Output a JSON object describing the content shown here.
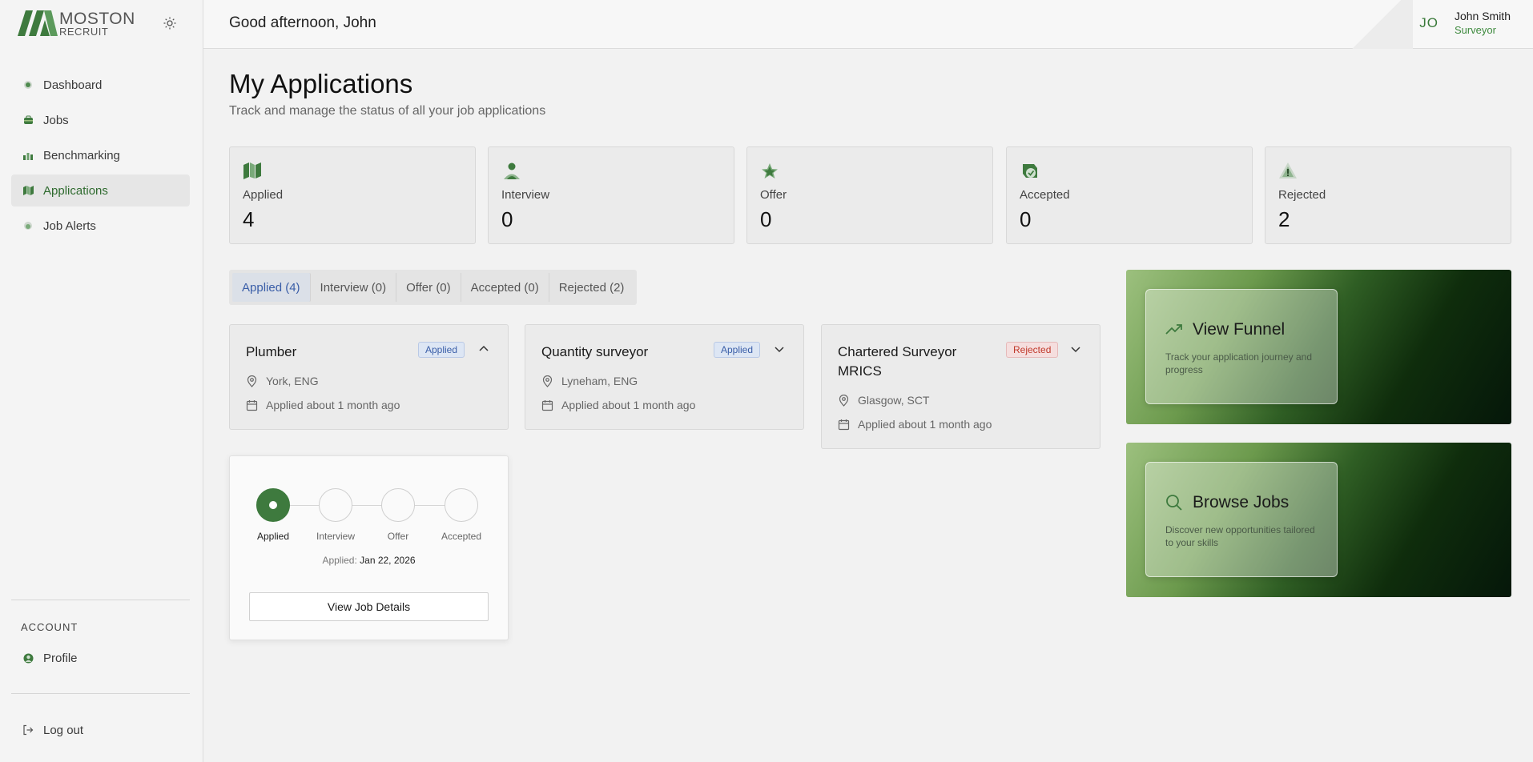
{
  "brand": {
    "name_line1": "MOSTON",
    "name_line2": "RECRUIT",
    "color": "#3e7a3e"
  },
  "sidebar": {
    "items": [
      {
        "label": "Dashboard",
        "icon": "dashboard-icon"
      },
      {
        "label": "Jobs",
        "icon": "briefcase-icon"
      },
      {
        "label": "Benchmarking",
        "icon": "chart-icon"
      },
      {
        "label": "Applications",
        "icon": "map-icon",
        "active": true
      },
      {
        "label": "Job Alerts",
        "icon": "bell-icon"
      }
    ],
    "account_label": "ACCOUNT",
    "profile_label": "Profile",
    "logout_label": "Log out"
  },
  "header": {
    "greeting": "Good afternoon, John",
    "avatar_initials": "JO",
    "user_name": "John Smith",
    "user_role": "Surveyor"
  },
  "page": {
    "title": "My Applications",
    "subtitle": "Track and manage the status of all your job applications"
  },
  "stats": [
    {
      "label": "Applied",
      "value": "4",
      "icon": "map-icon"
    },
    {
      "label": "Interview",
      "value": "0",
      "icon": "person-icon"
    },
    {
      "label": "Offer",
      "value": "0",
      "icon": "star-icon"
    },
    {
      "label": "Accepted",
      "value": "0",
      "icon": "check-badge-icon"
    },
    {
      "label": "Rejected",
      "value": "2",
      "icon": "warning-icon"
    }
  ],
  "tabs": [
    {
      "label": "Applied (4)",
      "active": true
    },
    {
      "label": "Interview (0)"
    },
    {
      "label": "Offer (0)"
    },
    {
      "label": "Accepted (0)"
    },
    {
      "label": "Rejected (2)"
    }
  ],
  "applications": [
    {
      "title": "Plumber",
      "status": "Applied",
      "location": "York, ENG",
      "applied": "Applied about 1 month ago",
      "expanded": true
    },
    {
      "title": "Quantity surveyor",
      "status": "Applied",
      "location": "Lyneham, ENG",
      "applied": "Applied about 1 month ago"
    },
    {
      "title": "Chartered Surveyor MRICS",
      "status": "Rejected",
      "location": "Glasgow, SCT",
      "applied": "Applied about 1 month ago"
    }
  ],
  "progress": {
    "steps": [
      "Applied",
      "Interview",
      "Offer",
      "Accepted"
    ],
    "current_step": 1,
    "applied_label": "Applied:",
    "applied_date": "Jan 22, 2026",
    "button_label": "View Job Details"
  },
  "promos": [
    {
      "title": "View Funnel",
      "description": "Track your application journey and progress",
      "icon": "trending-up-icon"
    },
    {
      "title": "Browse Jobs",
      "description": "Discover new opportunities tailored to your skills",
      "icon": "search-icon"
    }
  ]
}
